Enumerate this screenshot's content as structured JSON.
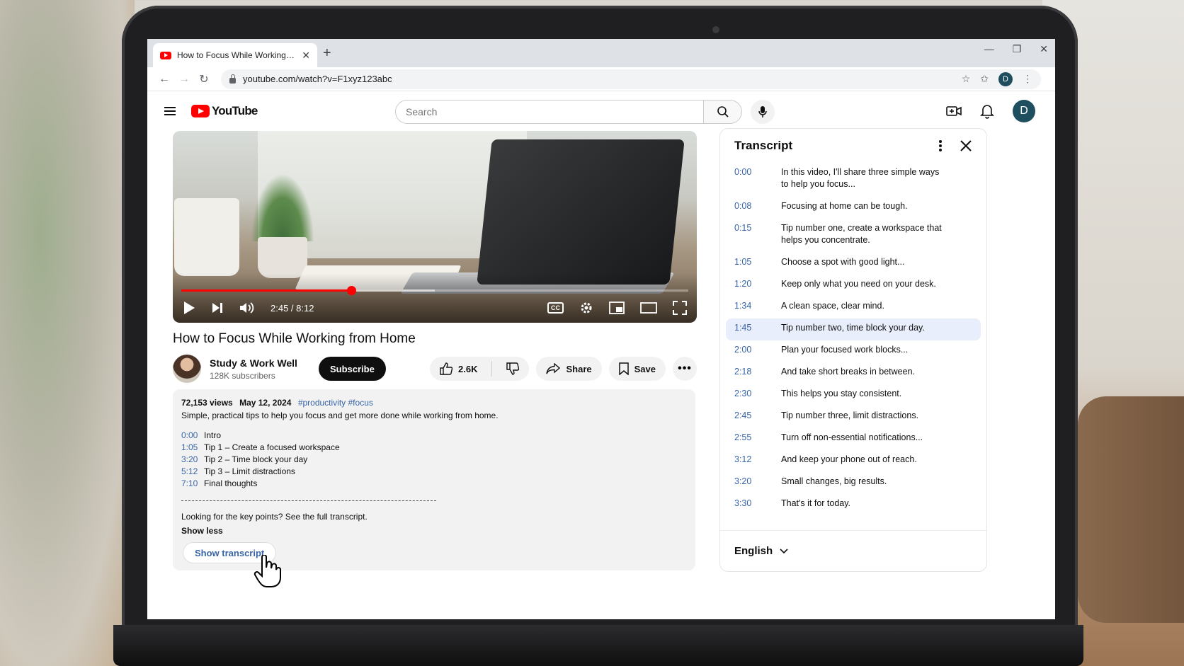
{
  "browser": {
    "tab_title": "How to Focus While Working fr...",
    "url": "youtube.com/watch?v=F1xyz123abc",
    "profile_initial": "D"
  },
  "youtube": {
    "logo_text": "YouTube",
    "search_placeholder": "Search",
    "avatar_initial": "D"
  },
  "player": {
    "timecode": "2:45 / 8:12",
    "progress": 0.335,
    "buffered": 0.5
  },
  "video": {
    "title": "How to Focus While Working from Home",
    "channel_name": "Study & Work Well",
    "subscribers": "128K subscribers",
    "subscribe_label": "Subscribe",
    "likes": "2.6K",
    "share_label": "Share",
    "save_label": "Save"
  },
  "description": {
    "views": "72,153 views",
    "date": "May 12, 2024",
    "hashtags": "#productivity #focus",
    "summary": "Simple, practical tips to help you focus and get more done while working from home.",
    "chapters": [
      {
        "ts": "0:00",
        "label": "Intro"
      },
      {
        "ts": "1:05",
        "label": "Tip 1 – Create a focused workspace"
      },
      {
        "ts": "3:20",
        "label": "Tip 2 – Time block your day"
      },
      {
        "ts": "5:12",
        "label": "Tip 3 – Limit distractions"
      },
      {
        "ts": "7:10",
        "label": "Final thoughts"
      }
    ],
    "key_points": "Looking for the key points? See the full transcript.",
    "show_less": "Show less",
    "show_transcript": "Show transcript"
  },
  "transcript": {
    "title": "Transcript",
    "language": "English",
    "active_index": 6,
    "lines": [
      {
        "ts": "0:00",
        "text": "In this video, I'll share three simple ways to help you focus..."
      },
      {
        "ts": "0:08",
        "text": "Focusing at home can be tough."
      },
      {
        "ts": "0:15",
        "text": "Tip number one, create a workspace that helps you concentrate."
      },
      {
        "ts": "1:05",
        "text": "Choose a spot with good light..."
      },
      {
        "ts": "1:20",
        "text": "Keep only what you need on your desk."
      },
      {
        "ts": "1:34",
        "text": "A clean space, clear mind."
      },
      {
        "ts": "1:45",
        "text": "Tip number two, time block your day."
      },
      {
        "ts": "2:00",
        "text": "Plan your focused work blocks..."
      },
      {
        "ts": "2:18",
        "text": "And take short breaks in between."
      },
      {
        "ts": "2:30",
        "text": "This helps you stay consistent."
      },
      {
        "ts": "2:45",
        "text": "Tip number three, limit distractions."
      },
      {
        "ts": "2:55",
        "text": "Turn off non-essential notifications..."
      },
      {
        "ts": "3:12",
        "text": "And keep your phone out of reach."
      },
      {
        "ts": "3:20",
        "text": "Small changes, big results."
      },
      {
        "ts": "3:30",
        "text": "That's it for today."
      }
    ]
  },
  "colors": {
    "brand_red": "#ff0000",
    "link_blue": "#3764a6",
    "active_row": "#e8eefb"
  }
}
